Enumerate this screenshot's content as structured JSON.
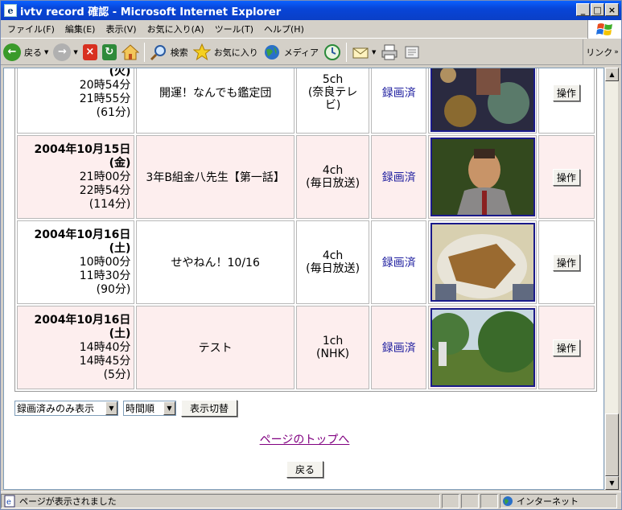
{
  "window": {
    "title": "ivtv record 確認 - Microsoft Internet Explorer"
  },
  "menu": [
    "ファイル(F)",
    "編集(E)",
    "表示(V)",
    "お気に入り(A)",
    "ツール(T)",
    "ヘルプ(H)"
  ],
  "toolbar": {
    "back": "戻る",
    "search": "検索",
    "favorites": "お気に入り",
    "media": "メディア",
    "links": "リンク"
  },
  "table": {
    "rows": [
      {
        "date": "",
        "day": "(火)",
        "start": "20時54分",
        "end": "21時55分",
        "dur": "(61分)",
        "title": "開運！なんでも鑑定団",
        "ch1": "5ch",
        "ch2": "(奈良テレ",
        "ch3": "ビ)",
        "status": "録画済",
        "op": "操作",
        "style": "white"
      },
      {
        "date": "2004年10月15日",
        "day": "(金)",
        "start": "21時00分",
        "end": "22時54分",
        "dur": "(114分)",
        "title": "3年B組金八先生【第一話】",
        "ch1": "4ch",
        "ch2": "(毎日放送)",
        "ch3": "",
        "status": "録画済",
        "op": "操作",
        "style": "pink"
      },
      {
        "date": "2004年10月16日",
        "day": "(土)",
        "start": "10時00分",
        "end": "11時30分",
        "dur": "(90分)",
        "title": "せやねん！10/16",
        "ch1": "4ch",
        "ch2": "(毎日放送)",
        "ch3": "",
        "status": "録画済",
        "op": "操作",
        "style": "white"
      },
      {
        "date": "2004年10月16日",
        "day": "(土)",
        "start": "14時40分",
        "end": "14時45分",
        "dur": "(5分)",
        "title": "テスト",
        "ch1": "1ch",
        "ch2": "(NHK)",
        "ch3": "",
        "status": "録画済",
        "op": "操作",
        "style": "pink"
      }
    ]
  },
  "controls": {
    "filter": "録画済みのみ表示",
    "sort": "時間順",
    "switch": "表示切替"
  },
  "page_top_link": "ページのトップへ",
  "back_button": "戻る",
  "status": {
    "text": "ページが表示されました",
    "zone": "インターネット"
  }
}
